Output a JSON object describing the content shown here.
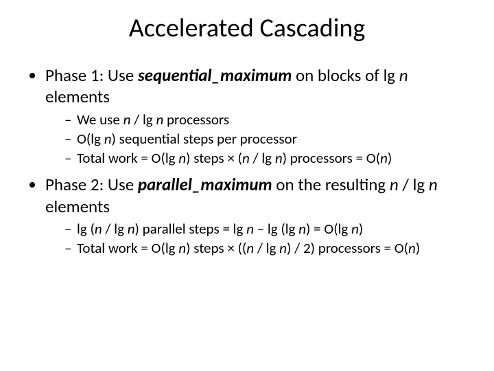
{
  "title": "Accelerated Cascading",
  "phase1": {
    "prefix": "Phase 1: Use ",
    "func": "sequential_maximum",
    "mid": " on blocks of lg ",
    "n": "n",
    "suffix": " elements",
    "sub": [
      {
        "a": "We use ",
        "b": "n",
        "c": " / lg ",
        "d": "n",
        "e": " processors"
      },
      {
        "a": "O(lg ",
        "b": "n",
        "c": ") sequential steps per processor"
      },
      {
        "a": "Total work = O(lg ",
        "b": "n",
        "c": ") steps × (",
        "d": "n",
        "e": " / lg ",
        "f": "n",
        "g": ") processors = O(",
        "h": "n",
        "i": ")"
      }
    ]
  },
  "phase2": {
    "prefix": "Phase 2: Use ",
    "func": "parallel_maximum",
    "mid": " on the resulting ",
    "n1": "n",
    "sep": " / lg ",
    "n2": "n",
    "suffix": " elements",
    "sub": [
      {
        "a": "lg (",
        "b": "n",
        "c": " / lg ",
        "d": "n",
        "e": ") parallel steps = lg ",
        "f": "n",
        "g": " – lg (lg ",
        "h": "n",
        "i": ") = O(lg ",
        "j": "n",
        "k": ")"
      },
      {
        "a": "Total work = O(lg ",
        "b": "n",
        "c": ") steps × ((",
        "d": "n",
        "e": " / lg ",
        "f": "n",
        "g": ") / 2) processors = O(",
        "h": "n",
        "i": ")"
      }
    ]
  }
}
